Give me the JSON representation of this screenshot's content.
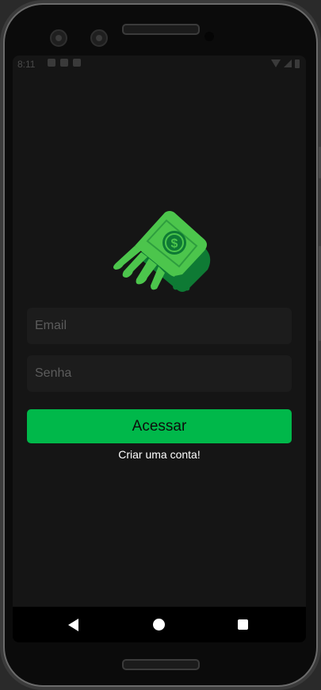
{
  "app": {
    "logo_icon": "flying-money-icon"
  },
  "statusbar": {
    "time": "8:11"
  },
  "form": {
    "email_placeholder": "Email",
    "password_placeholder": "Senha",
    "login_label": "Acessar",
    "create_account_label": "Criar uma conta!"
  },
  "colors": {
    "background": "#151515",
    "accent": "#00b84a",
    "input_bg": "#1c1c1c",
    "money_light": "#4cc54c",
    "money_dark": "#0e7a34"
  },
  "navbar": {
    "back_icon": "back-triangle-icon",
    "home_icon": "home-circle-icon",
    "recents_icon": "recents-square-icon"
  }
}
